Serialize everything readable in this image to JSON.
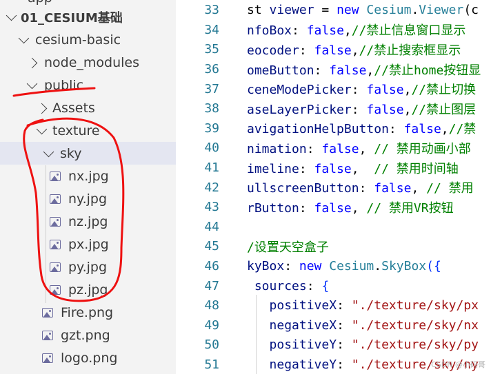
{
  "explorer": {
    "top_cut": "app",
    "root": "01_CESIUM基础",
    "cesium_basic": "cesium-basic",
    "node_modules": "node_modules",
    "public": "public",
    "assets": "Assets",
    "texture": "texture",
    "sky": "sky",
    "sky_files": [
      "nx.jpg",
      "ny.jpg",
      "nz.jpg",
      "px.jpg",
      "py.jpg",
      "pz.jpg"
    ],
    "other_files": [
      "Fire.png",
      "gzt.png",
      "logo.png"
    ]
  },
  "editor": {
    "lines": [
      {
        "n": "33",
        "parts": [
          [
            "p",
            "st "
          ],
          [
            "v",
            "viewer"
          ],
          [
            "p",
            " = "
          ],
          [
            "k",
            "new "
          ],
          [
            "cls",
            "Cesium"
          ],
          [
            "p",
            "."
          ],
          [
            "cls",
            "Viewer"
          ],
          [
            "p",
            "(c"
          ]
        ]
      },
      {
        "n": "34",
        "parts": [
          [
            "v",
            "nfoBox"
          ],
          [
            "p",
            ": "
          ],
          [
            "k",
            "false"
          ],
          [
            "p",
            ","
          ],
          [
            "c",
            "//禁止信息窗口显示"
          ]
        ]
      },
      {
        "n": "35",
        "parts": [
          [
            "v",
            "eocoder"
          ],
          [
            "p",
            ": "
          ],
          [
            "k",
            "false"
          ],
          [
            "p",
            ","
          ],
          [
            "c",
            "//禁止搜索框显示"
          ]
        ]
      },
      {
        "n": "36",
        "parts": [
          [
            "v",
            "omeButton"
          ],
          [
            "p",
            ": "
          ],
          [
            "k",
            "false"
          ],
          [
            "p",
            ","
          ],
          [
            "c",
            "//禁止home按钮显"
          ]
        ]
      },
      {
        "n": "37",
        "parts": [
          [
            "v",
            "ceneModePicker"
          ],
          [
            "p",
            ": "
          ],
          [
            "k",
            "false"
          ],
          [
            "p",
            ","
          ],
          [
            "c",
            "//禁止切换"
          ]
        ]
      },
      {
        "n": "38",
        "parts": [
          [
            "v",
            "aseLayerPicker"
          ],
          [
            "p",
            ": "
          ],
          [
            "k",
            "false"
          ],
          [
            "p",
            ","
          ],
          [
            "c",
            "//禁止图层"
          ]
        ]
      },
      {
        "n": "39",
        "parts": [
          [
            "v",
            "avigationHelpButton"
          ],
          [
            "p",
            ": "
          ],
          [
            "k",
            "false"
          ],
          [
            "p",
            ","
          ],
          [
            "c",
            "//禁"
          ]
        ]
      },
      {
        "n": "40",
        "parts": [
          [
            "v",
            "nimation"
          ],
          [
            "p",
            ": "
          ],
          [
            "k",
            "false"
          ],
          [
            "p",
            ", "
          ],
          [
            "c",
            "// 禁用动画小部"
          ]
        ]
      },
      {
        "n": "41",
        "parts": [
          [
            "v",
            "imeline"
          ],
          [
            "p",
            ": "
          ],
          [
            "k",
            "false"
          ],
          [
            "p",
            ",  "
          ],
          [
            "c",
            "// 禁用时间轴"
          ]
        ]
      },
      {
        "n": "42",
        "parts": [
          [
            "v",
            "ullscreenButton"
          ],
          [
            "p",
            ": "
          ],
          [
            "k",
            "false"
          ],
          [
            "p",
            ", "
          ],
          [
            "c",
            "// 禁用"
          ]
        ]
      },
      {
        "n": "43",
        "parts": [
          [
            "v",
            "rButton"
          ],
          [
            "p",
            ": "
          ],
          [
            "k",
            "false"
          ],
          [
            "p",
            ", "
          ],
          [
            "c",
            "// 禁用VR按钮"
          ]
        ]
      },
      {
        "n": "44",
        "parts": []
      },
      {
        "n": "45",
        "parts": [
          [
            "c",
            "/设置天空盒子"
          ]
        ]
      },
      {
        "n": "46",
        "parts": [
          [
            "v",
            "kyBox"
          ],
          [
            "p",
            ": "
          ],
          [
            "k",
            "new "
          ],
          [
            "cls",
            "Cesium"
          ],
          [
            "p",
            "."
          ],
          [
            "cls",
            "SkyBox"
          ],
          [
            "brk",
            "("
          ],
          [
            "brk",
            "{"
          ]
        ]
      },
      {
        "n": "47",
        "parts": [
          [
            "p",
            " "
          ],
          [
            "v",
            "sources"
          ],
          [
            "p",
            ": "
          ],
          [
            "brk",
            "{"
          ]
        ]
      },
      {
        "n": "48",
        "parts": [
          [
            "p",
            "   "
          ],
          [
            "v",
            "positiveX"
          ],
          [
            "p",
            ": "
          ],
          [
            "s",
            "\"./texture/sky/px"
          ]
        ]
      },
      {
        "n": "49",
        "parts": [
          [
            "p",
            "   "
          ],
          [
            "v",
            "negativeX"
          ],
          [
            "p",
            ": "
          ],
          [
            "s",
            "\"./texture/sky/nx"
          ]
        ]
      },
      {
        "n": "50",
        "parts": [
          [
            "p",
            "   "
          ],
          [
            "v",
            "positiveY"
          ],
          [
            "p",
            ": "
          ],
          [
            "s",
            "\"./texture/sky/py"
          ]
        ]
      },
      {
        "n": "51",
        "parts": [
          [
            "p",
            "   "
          ],
          [
            "v",
            "negativeY"
          ],
          [
            "p",
            ": "
          ],
          [
            "s",
            "\"./texture/sky/ny"
          ]
        ]
      }
    ]
  },
  "watermark": "CSDN @小码哥"
}
